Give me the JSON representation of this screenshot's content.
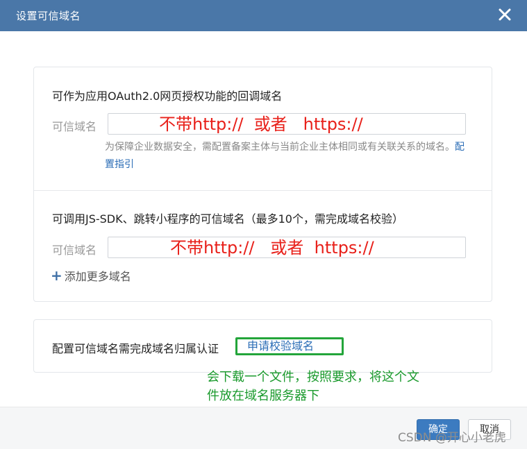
{
  "dialog": {
    "title": "设置可信域名",
    "close_icon": "close-icon"
  },
  "oauth_section": {
    "title": "可作为应用OAuth2.0网页授权功能的回调域名",
    "field_label": "可信域名",
    "annotation": "不带http://  或者   https://",
    "hint_text": "为保障企业数据安全，需配置备案主体与当前企业主体相同或有关联关系的域名。",
    "hint_link": "配置指引"
  },
  "jssdk_section": {
    "title": "可调用JS-SDK、跳转小程序的可信域名（最多10个，需完成域名校验）",
    "field_label": "可信域名",
    "annotation": "不带http://   或者  https://",
    "add_more": "添加更多域名"
  },
  "verify_section": {
    "text": "配置可信域名需完成域名归属认证",
    "button": "申请校验域名"
  },
  "annotation_note": {
    "line1": "会下载一个文件，按照要求，将这个文",
    "line2": "件放在域名服务器下"
  },
  "footer": {
    "ok": "确定",
    "cancel": "取消"
  },
  "watermark": "CSDN @开心小老虎",
  "colors": {
    "titlebar": "#4a77a8",
    "annotation_red": "#e8201a",
    "annotation_green": "#1a9a2c",
    "link": "#2b6db6",
    "primary_button": "#3c7bc0"
  }
}
